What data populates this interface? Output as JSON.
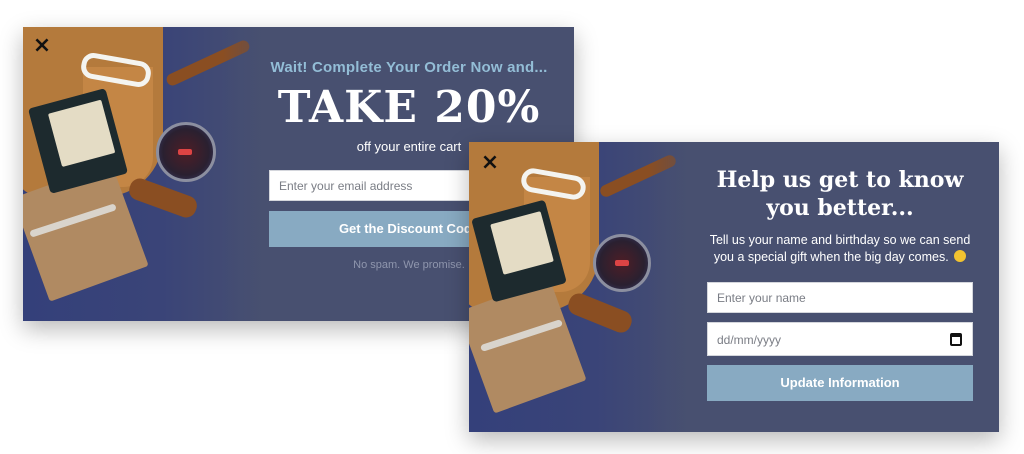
{
  "popup1": {
    "close_icon": "×",
    "eyebrow": "Wait! Complete Your Order Now and...",
    "headline": "TAKE 20%",
    "subline": "off your entire cart",
    "email_placeholder": "Enter your email address",
    "cta_label": "Get the Discount Code",
    "fineprint": "No spam. We promise."
  },
  "popup2": {
    "close_icon": "×",
    "title": "Help us get to know you better...",
    "description": "Tell us your name and birthday so we can send you a special gift when the big day comes.",
    "name_placeholder": "Enter your name",
    "date_placeholder": "dd/mm/yyyy",
    "cta_label": "Update Information"
  },
  "colors": {
    "panel_bg": "#485070",
    "accent_button": "#88aac2",
    "eyebrow_text": "#93bdd6"
  },
  "icons": {
    "close": "close-icon",
    "calendar": "calendar-icon",
    "emoji": "winking-face-icon"
  }
}
